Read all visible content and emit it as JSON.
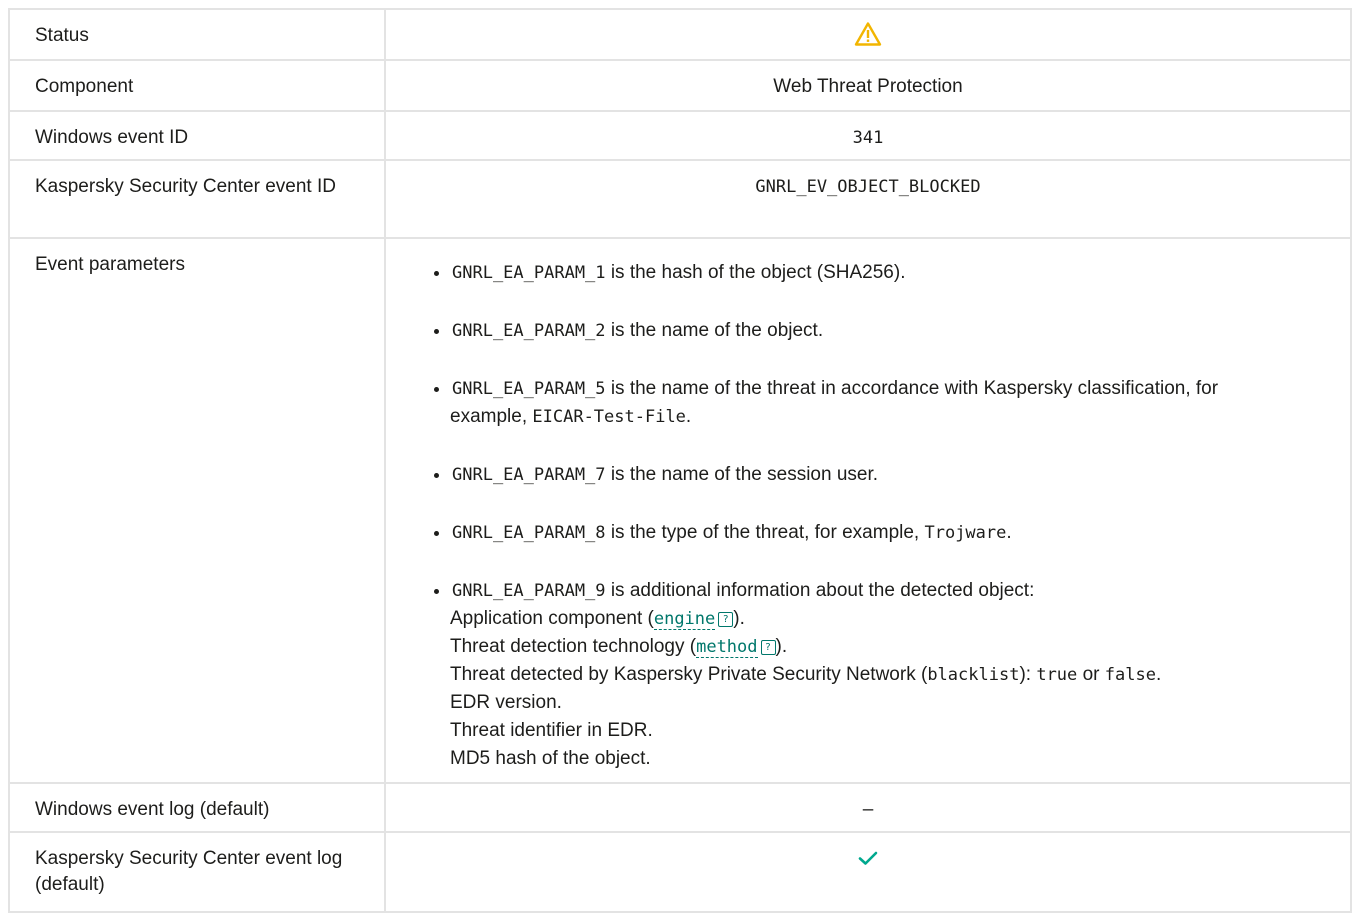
{
  "rows": {
    "status": {
      "label": "Status",
      "icon": "warning-triangle-icon",
      "icon_color": "#f2b500"
    },
    "component": {
      "label": "Component",
      "value": "Web Threat Protection"
    },
    "win_event_id": {
      "label": "Windows event ID",
      "value": "341"
    },
    "ksc_event_id": {
      "label": "Kaspersky Security Center event ID",
      "value": "GNRL_EV_OBJECT_BLOCKED"
    },
    "event_params": {
      "label": "Event parameters"
    },
    "win_event_log": {
      "label": "Windows event log (default)",
      "value": "–"
    },
    "ksc_event_log": {
      "label": "Kaspersky Security Center event log (default)",
      "icon": "checkmark-icon",
      "icon_color": "#00a88e"
    }
  },
  "params": {
    "p1": {
      "code": "GNRL_EA_PARAM_1",
      "text": "is the hash of the object (SHA256)."
    },
    "p2": {
      "code": "GNRL_EA_PARAM_2",
      "text": "is the name of the object."
    },
    "p5": {
      "code": "GNRL_EA_PARAM_5",
      "text": "is the name of the threat in accordance with Kaspersky classification, for",
      "text2": "example,",
      "example": "EICAR-Test-File",
      "end": "."
    },
    "p7": {
      "code": "GNRL_EA_PARAM_7",
      "text": "is the name of the session user."
    },
    "p8": {
      "code": "GNRL_EA_PARAM_8",
      "text": "is the type of the threat, for example,",
      "example": "Trojware",
      "end": "."
    },
    "p9": {
      "code": "GNRL_EA_PARAM_9",
      "text": "is additional information about the detected object:",
      "app_component": "Application component (",
      "engine": "engine",
      "close_paren": ").",
      "detection_tech": "Threat detection technology (",
      "method": "method",
      "ksn_text": "Threat detected by Kaspersky Private Security Network (",
      "blacklist": "blacklist",
      "ksn_mid": "):",
      "true_val": "true",
      "or": "or",
      "false_val": "false",
      "period": ".",
      "edr_version": "EDR version.",
      "edr_id": "Threat identifier in EDR.",
      "md5": "MD5 hash of the object."
    }
  }
}
